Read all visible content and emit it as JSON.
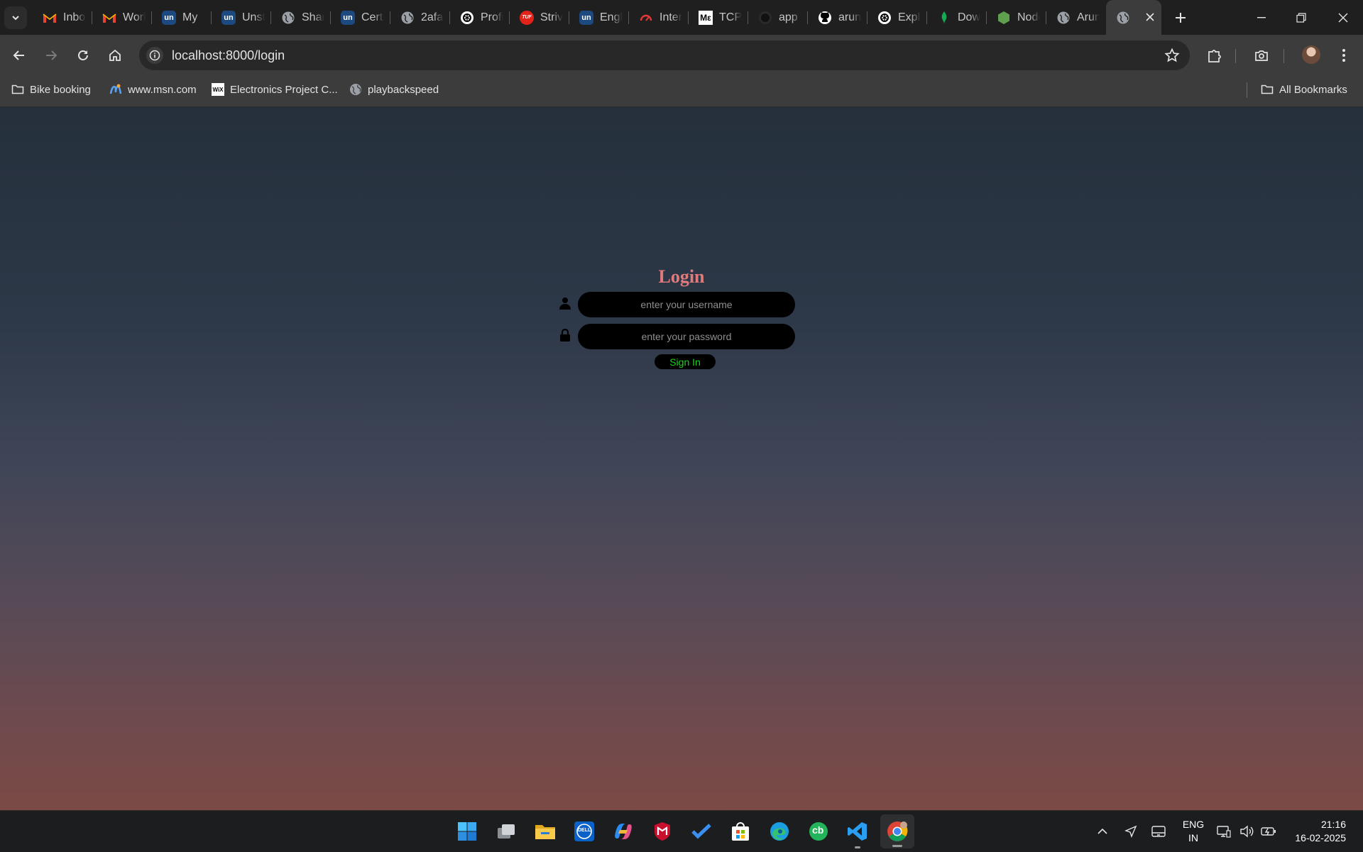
{
  "browser": {
    "tabs": [
      {
        "label": "Inbox",
        "icon": "gmail-icon"
      },
      {
        "label": "Workspace",
        "icon": "gmail-icon"
      },
      {
        "label": "My",
        "icon": "unstop-icon"
      },
      {
        "label": "Unstop",
        "icon": "unstop-icon"
      },
      {
        "label": "Share",
        "icon": "globe-icon"
      },
      {
        "label": "Certificate",
        "icon": "unstop-icon"
      },
      {
        "label": "2afa",
        "icon": "globe-icon"
      },
      {
        "label": "Profile",
        "icon": "openai-icon"
      },
      {
        "label": "Striver",
        "icon": "tuf-icon"
      },
      {
        "label": "English",
        "icon": "unstop-icon"
      },
      {
        "label": "Interview",
        "icon": "gauge-icon"
      },
      {
        "label": "TCP",
        "icon": "medium-icon"
      },
      {
        "label": "app",
        "icon": "github-dark-icon"
      },
      {
        "label": "arun",
        "icon": "github-icon"
      },
      {
        "label": "Explore",
        "icon": "openai-icon"
      },
      {
        "label": "Download",
        "icon": "mongodb-icon"
      },
      {
        "label": "Node",
        "icon": "nodejs-icon"
      },
      {
        "label": "Arun",
        "icon": "globe-icon"
      },
      {
        "label": "",
        "icon": "globe-icon",
        "active": true
      }
    ],
    "fav_text": {
      "tuf": "TUF",
      "unstop": "un",
      "medium": "Mε"
    },
    "url": "localhost:8000/login",
    "bookmarks": [
      {
        "label": "Bike booking",
        "icon": "folder-icon"
      },
      {
        "label": "www.msn.com",
        "icon": "msn-icon"
      },
      {
        "label": "Electronics Project C...",
        "icon": "wix-icon"
      },
      {
        "label": "playbackspeed",
        "icon": "globe-icon"
      }
    ],
    "all_bookmarks": "All Bookmarks",
    "wix_text": "WiX"
  },
  "login": {
    "title": "Login",
    "username_placeholder": "enter your username",
    "password_placeholder": "enter your password",
    "signin_label": "Sign In"
  },
  "taskbar": {
    "dell_text": "DELL",
    "cb_text": "cb",
    "lang": {
      "line1": "ENG",
      "line2": "IN"
    },
    "clock": {
      "time": "21:16",
      "date": "16-02-2025"
    }
  },
  "colors": {
    "title": "#e07b7b",
    "signin_text": "#19d419",
    "input_bg": "#000000"
  }
}
